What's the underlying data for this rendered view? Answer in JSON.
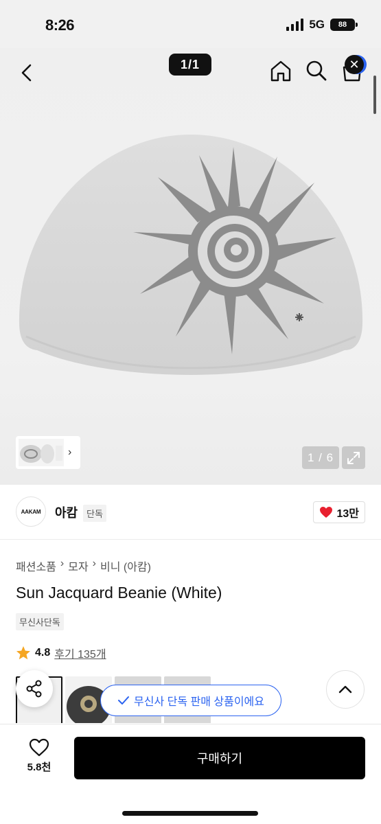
{
  "status_bar": {
    "time": "8:26",
    "network": "5G",
    "battery": "88"
  },
  "header": {
    "image_counter": "1/1",
    "close_label": "✕",
    "icons": [
      "back-chevron-icon",
      "home-icon",
      "search-icon",
      "cart-icon"
    ]
  },
  "gallery_controls": {
    "photo_counter": "1 / 6",
    "thumb_arrow": "›"
  },
  "brand": {
    "logo_text": "AAKAM",
    "name": "아캄",
    "tag": "단독",
    "likes": "13만"
  },
  "product": {
    "breadcrumb": [
      "패션소품",
      "모자",
      "비니 (아캄)"
    ],
    "breadcrumb_sep": "›",
    "title": "Sun Jacquard Beanie (White)",
    "exclusive_tag": "무신사단독",
    "rating": "4.8",
    "review_label": "후기 135개"
  },
  "toast": {
    "text": "무신사 단독 판매 상품이에요"
  },
  "bottom_bar": {
    "wish_count": "5.8천",
    "buy_label": "구매하기"
  },
  "colors": {
    "accent_blue": "#2b63f0",
    "heart_red": "#e8202f",
    "star_yellow": "#f5a623",
    "beanie_light": "#d9d9d9",
    "beanie_pattern": "#8c8c8c"
  }
}
